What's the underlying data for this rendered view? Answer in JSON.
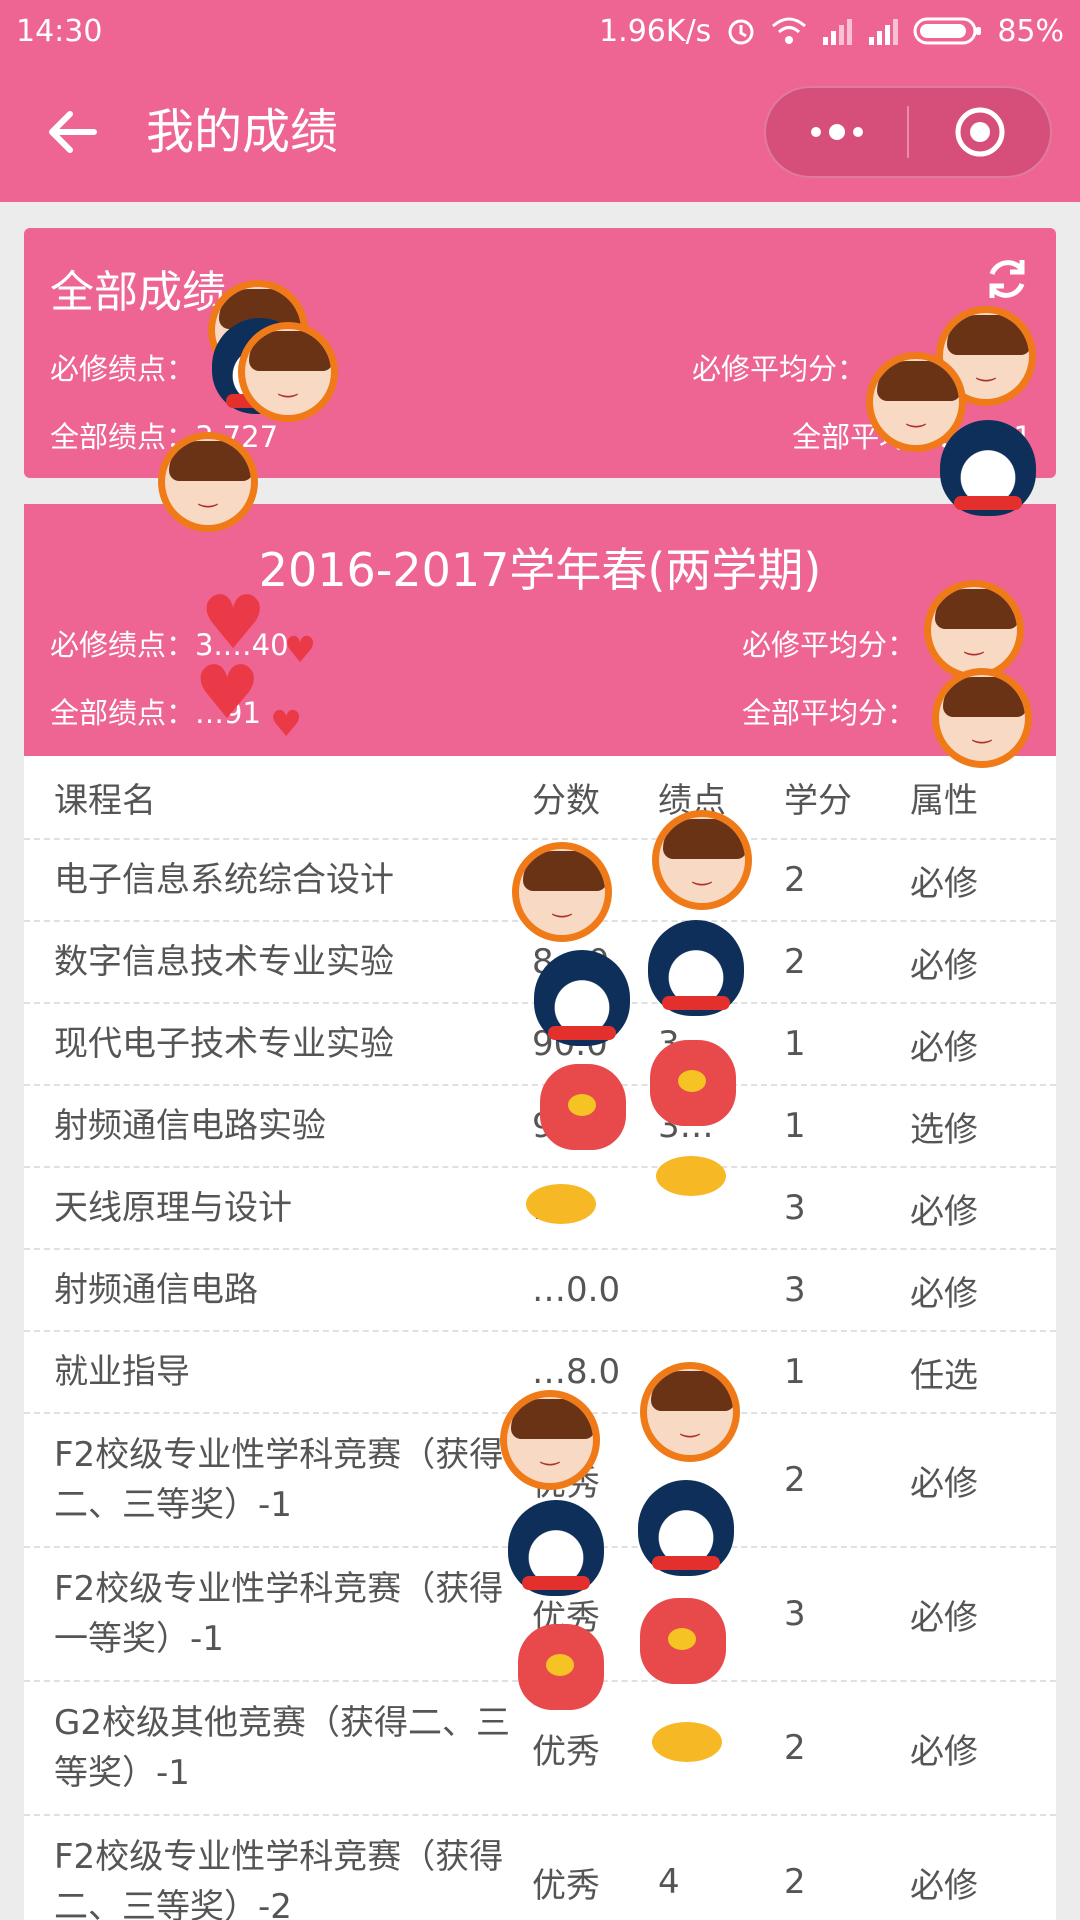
{
  "status_bar": {
    "time": "14:30",
    "net_speed": "1.96K/s",
    "battery": "85%",
    "icons": [
      "alarm-icon",
      "wifi-icon",
      "signal-icon",
      "signal-icon",
      "battery-icon"
    ]
  },
  "nav": {
    "title": "我的成绩",
    "back_icon": "back-arrow-icon",
    "menu_icon": "more-dots-icon",
    "close_icon": "target-circle-icon"
  },
  "summary": {
    "title": "全部成绩",
    "req_gpa_label": "必修绩点：",
    "req_avg_label": "必修平均分：",
    "all_gpa_label": "全部绩点：",
    "all_gpa_value": "3.727",
    "all_avg_label": "全部平均分：",
    "all_avg_value": "…91"
  },
  "term": {
    "title": "2016-2017学年春(两学期)",
    "req_gpa_label": "必修绩点：",
    "req_gpa_value": "3.…40",
    "req_avg_label": "必修平均分：",
    "all_gpa_label": "全部绩点：",
    "all_gpa_value": "…91",
    "all_avg_label": "全部平均分："
  },
  "table": {
    "headers": [
      "课程名",
      "分数",
      "绩点",
      "学分",
      "属性"
    ],
    "rows": [
      {
        "name": "电子信息系统综合设计",
        "score": "",
        "gpa": "",
        "credit": "2",
        "type": "必修"
      },
      {
        "name": "数字信息技术专业实验",
        "score": "8…0",
        "gpa": "",
        "credit": "2",
        "type": "必修"
      },
      {
        "name": "现代电子技术专业实验",
        "score": "90.0",
        "gpa": "3…",
        "credit": "1",
        "type": "必修"
      },
      {
        "name": "射频通信电路实验",
        "score": "9…",
        "gpa": "3…",
        "credit": "1",
        "type": "选修"
      },
      {
        "name": "天线原理与设计",
        "score": "…0",
        "gpa": "",
        "credit": "3",
        "type": "必修"
      },
      {
        "name": "射频通信电路",
        "score": "…0.0",
        "gpa": "",
        "credit": "3",
        "type": "必修"
      },
      {
        "name": "就业指导",
        "score": "…8.0",
        "gpa": "",
        "credit": "1",
        "type": "任选"
      },
      {
        "name": "F2校级专业性学科竞赛（获得二、三等奖）-1",
        "score": "优秀",
        "gpa": "",
        "credit": "2",
        "type": "必修"
      },
      {
        "name": "F2校级专业性学科竞赛（获得一等奖）-1",
        "score": "优秀",
        "gpa": "4",
        "credit": "3",
        "type": "必修"
      },
      {
        "name": "G2校级其他竞赛（获得二、三等奖）-1",
        "score": "优秀",
        "gpa": "",
        "credit": "2",
        "type": "必修"
      },
      {
        "name": "F2校级专业性学科竞赛（获得二、三等奖）-2",
        "score": "优秀",
        "gpa": "4",
        "credit": "2",
        "type": "必修"
      }
    ]
  },
  "colors": {
    "brand_pink": "#ee6593",
    "sticker_orange": "#ef7a17",
    "sticker_red": "#ea3a48"
  }
}
